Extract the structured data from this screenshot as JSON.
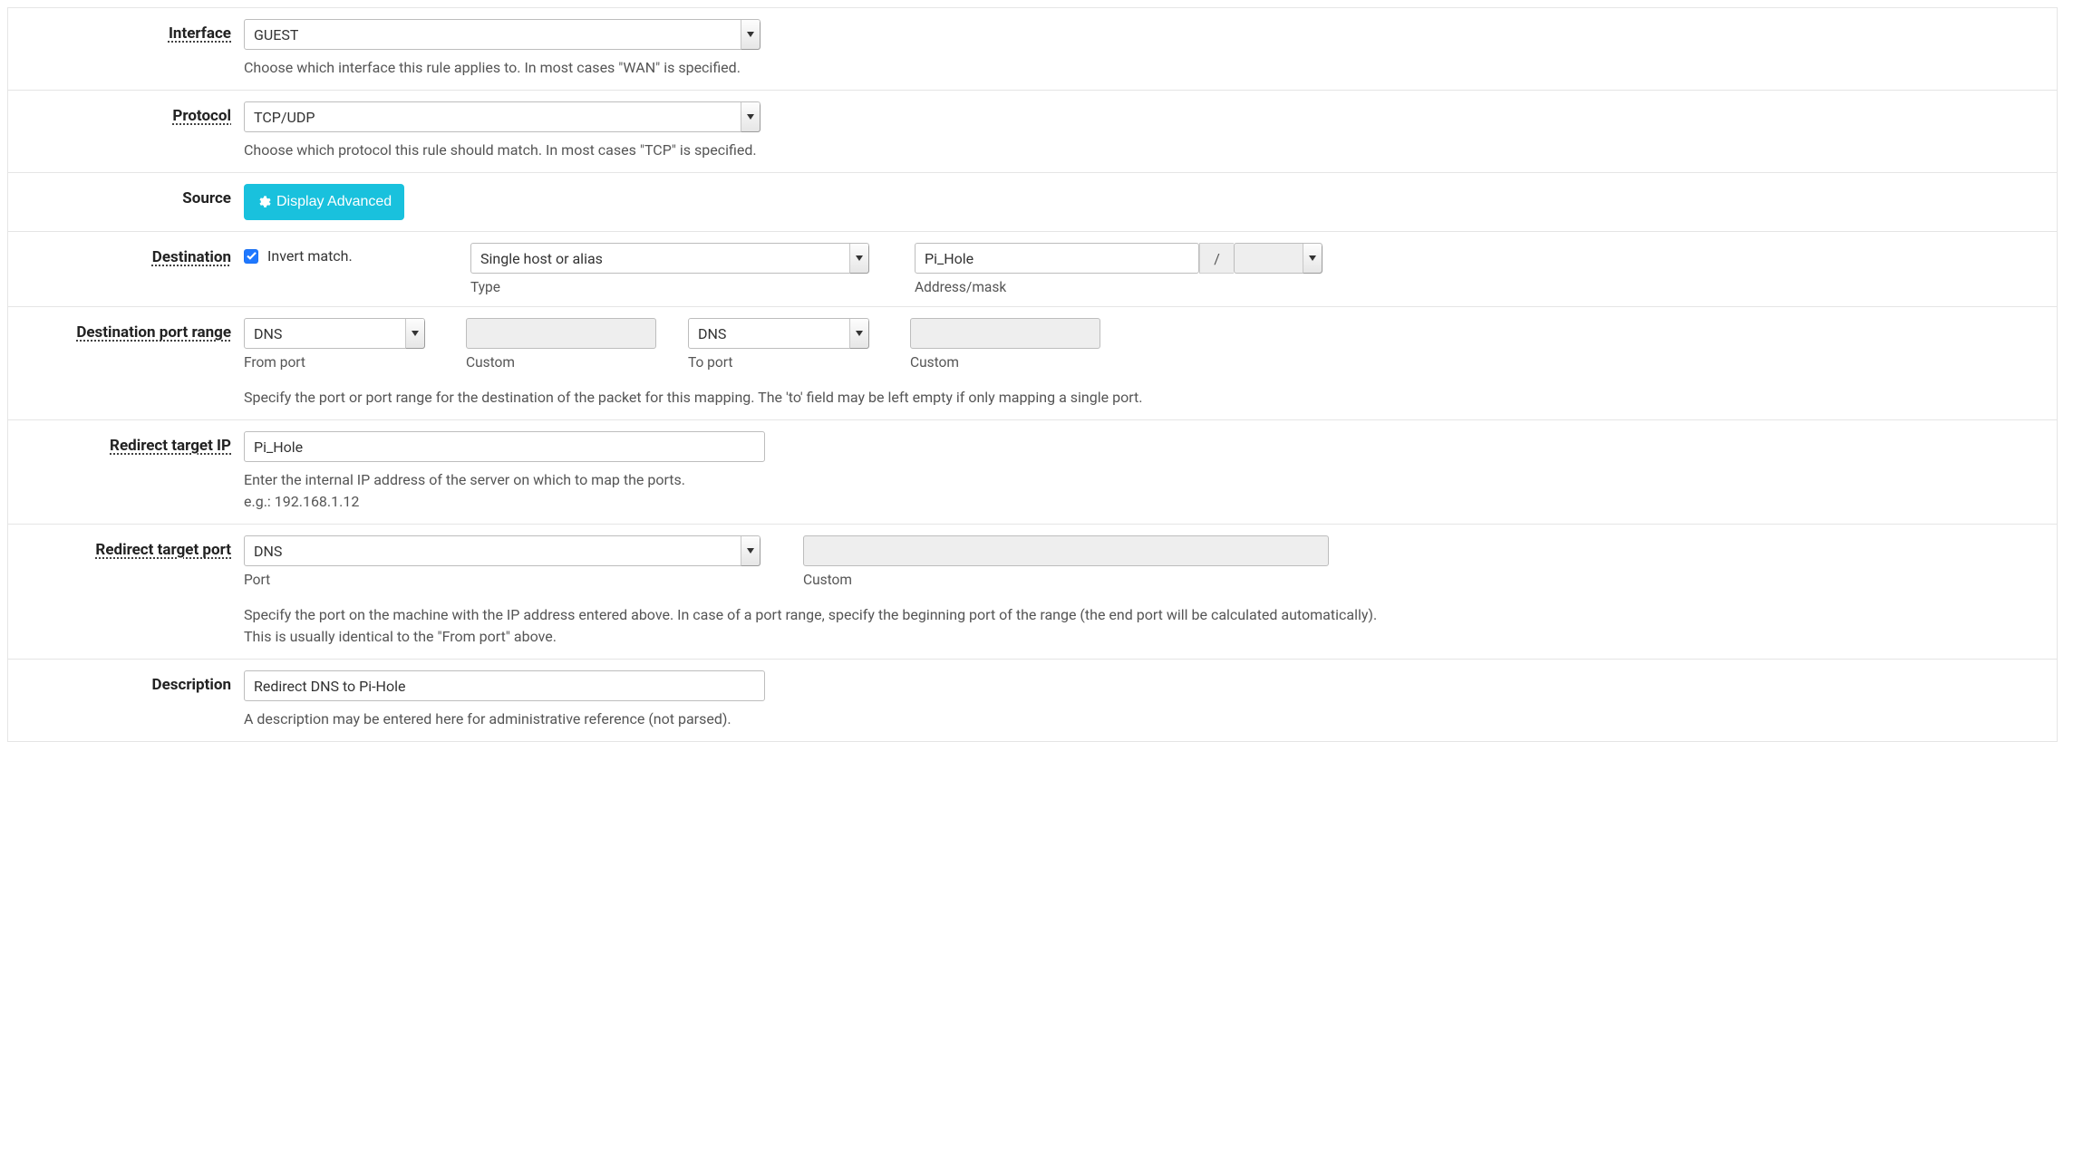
{
  "interface": {
    "label": "Interface",
    "value": "GUEST",
    "help": "Choose which interface this rule applies to. In most cases \"WAN\" is specified."
  },
  "protocol": {
    "label": "Protocol",
    "value": "TCP/UDP",
    "help": "Choose which protocol this rule should match. In most cases \"TCP\" is specified."
  },
  "source": {
    "label": "Source",
    "button": "Display Advanced"
  },
  "destination": {
    "label": "Destination",
    "invert_checked": true,
    "invert_label": "Invert match.",
    "type_value": "Single host or alias",
    "type_sub": "Type",
    "addr_value": "Pi_Hole",
    "mask_sep": "/",
    "mask_value": "",
    "addr_sub": "Address/mask"
  },
  "dpr": {
    "label": "Destination port range",
    "from_value": "DNS",
    "from_sub": "From port",
    "custom1_sub": "Custom",
    "to_value": "DNS",
    "to_sub": "To port",
    "custom2_sub": "Custom",
    "help": "Specify the port or port range for the destination of the packet for this mapping. The 'to' field may be left empty if only mapping a single port."
  },
  "redirect_ip": {
    "label": "Redirect target IP",
    "value": "Pi_Hole",
    "help1": "Enter the internal IP address of the server on which to map the ports.",
    "help2": "e.g.: 192.168.1.12"
  },
  "redirect_port": {
    "label": "Redirect target port",
    "port_value": "DNS",
    "port_sub": "Port",
    "custom_sub": "Custom",
    "help1": "Specify the port on the machine with the IP address entered above. In case of a port range, specify the beginning port of the range (the end port will be calculated automatically).",
    "help2": "This is usually identical to the \"From port\" above."
  },
  "description": {
    "label": "Description",
    "value": "Redirect DNS to Pi-Hole",
    "help": "A description may be entered here for administrative reference (not parsed)."
  }
}
